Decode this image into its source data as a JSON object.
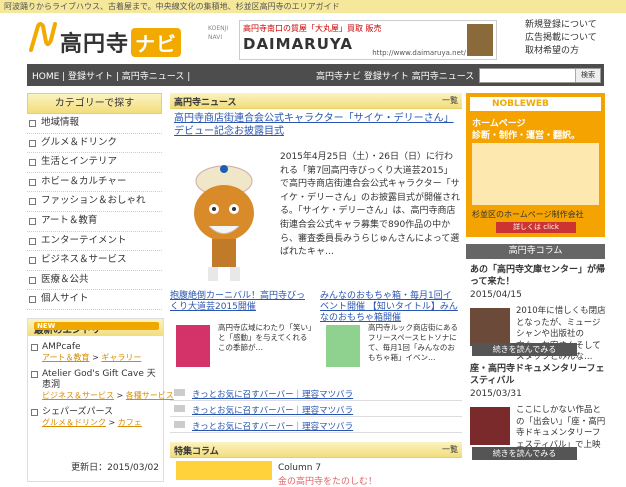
{
  "topbar": {
    "tagline": "阿波踊りからライブハウス、古着屋まで。中央線文化の集積地、杉並区高円寺のエリアガイド"
  },
  "logo": {
    "name": "高円寺",
    "navi": "ナビ",
    "sub": "KOENJI NAVI"
  },
  "banner": {
    "line1": "高円寺南口の質屋「大丸屋」買取 販売",
    "main": "DAIMARUYA",
    "url": "http://www.daimaruya.net/"
  },
  "header_links": [
    "新規登録について",
    "広告掲載について",
    "取材希望の方"
  ],
  "navbar": {
    "left": "HOME | 登録サイト | 高円寺ニュース |",
    "right": "高円寺ナビ  登録サイト  高円寺ニュース",
    "search_placeholder": "",
    "search_button": "検索"
  },
  "categories": {
    "header": "カテゴリーで探す",
    "items": [
      "地域情報",
      "グルメ＆ドリンク",
      "生活とインテリア",
      "ホビー＆カルチャー",
      "ファッション＆おしゃれ",
      "アート＆教育",
      "エンターテイメント",
      "ビジネス＆サービス",
      "医療＆公共",
      "個人サイト"
    ]
  },
  "latest": {
    "header": "最新のエントリー",
    "badge": "NEW",
    "entries": [
      {
        "title": "AMPcafe",
        "cat1": "アート＆教育",
        "cat2": "ギャラリー"
      },
      {
        "title": "Atelier God's Gift Cave 天恵洞",
        "cat1": "ビジネス＆サービス",
        "cat2": "各種サービス"
      },
      {
        "title": "シェパーズパース",
        "cat1": "グルメ＆ドリンク",
        "cat2": "カフェ"
      }
    ],
    "updated": "更新日：2015/03/02"
  },
  "news": {
    "header": "高円寺ニュース",
    "more": "一覧",
    "feature_title": "高円寺商店街連合会公式キャラクター「サイケ・デリーさん」デビュー記念お披露目式",
    "feature_text": "2015年4月25日（土）・26日（日）に行われる「第7回高円寺びっくり大道芸2015」で高円寺商店街連合会公式キャラクター「サイケ・デリーさん」のお披露目式が開催される。「サイケ・デリーさん」は、高円寺商店街連合会公式キャラ募集で890作品の中から、審査委員長みうらじゅんさんによって選ばれたキャ…",
    "sub1_title": "抱腹絶倒カーニバル！高円寺びっくり大道芸2015開催",
    "sub1_text": "高円寺広域にわたり「笑い」と「感動」を与えてくれるこの季節が…",
    "sub2_title": "みんなのおもちゃ箱・毎月1回イベント開催 【知いタイトル】みんなのおもちゃ箱開催",
    "sub2_text": "高円寺ルック商店街にあるフリースペースヒトソナにて、毎月1回「みんなのおもちゃ箱」イベン…",
    "links": [
      "きっとお気に召すバーバー｜理容マツバラ",
      "きっとお気に召すバーバー｜理容マツバラ",
      "きっとお気に召すバーバー｜理容マツバラ"
    ]
  },
  "column": {
    "header": "特集コラム",
    "more": "一覧",
    "number": "Column 7",
    "subtitle": "金の高円寺をたのしむ！"
  },
  "right": {
    "ad_brand": "NOBLEWEB",
    "ad_line1": "ホームページ",
    "ad_line2": "診断・制作・運営・翻訳。",
    "ad_line3": "杉並区のホームページ制作会社",
    "ad_cta": "詳しくは click",
    "section": "高円寺コラム",
    "posts": [
      {
        "title": "あの「高円寺文庫センター」が帰って来た！",
        "date": "2015/04/15",
        "text": "2010年に惜しくも閉店となったが、ミュージシャンや出版社の方々、お客さんそしてスタッフとみんな…",
        "button": "続きを読んでみる"
      },
      {
        "title": "座・高円寺ドキュメンタリーフェスティバル",
        "date": "2015/03/31",
        "text": "ここにしかない作品との「出会い」「座・高円寺ドキュメンタリーフェスティバル」で上映されている…",
        "button": "続きを読んでみる"
      }
    ]
  },
  "colors": {
    "accent": "#f2a900",
    "nav": "#4d4d4d",
    "link": "#2a55b0",
    "orange_link": "#d98b00"
  }
}
